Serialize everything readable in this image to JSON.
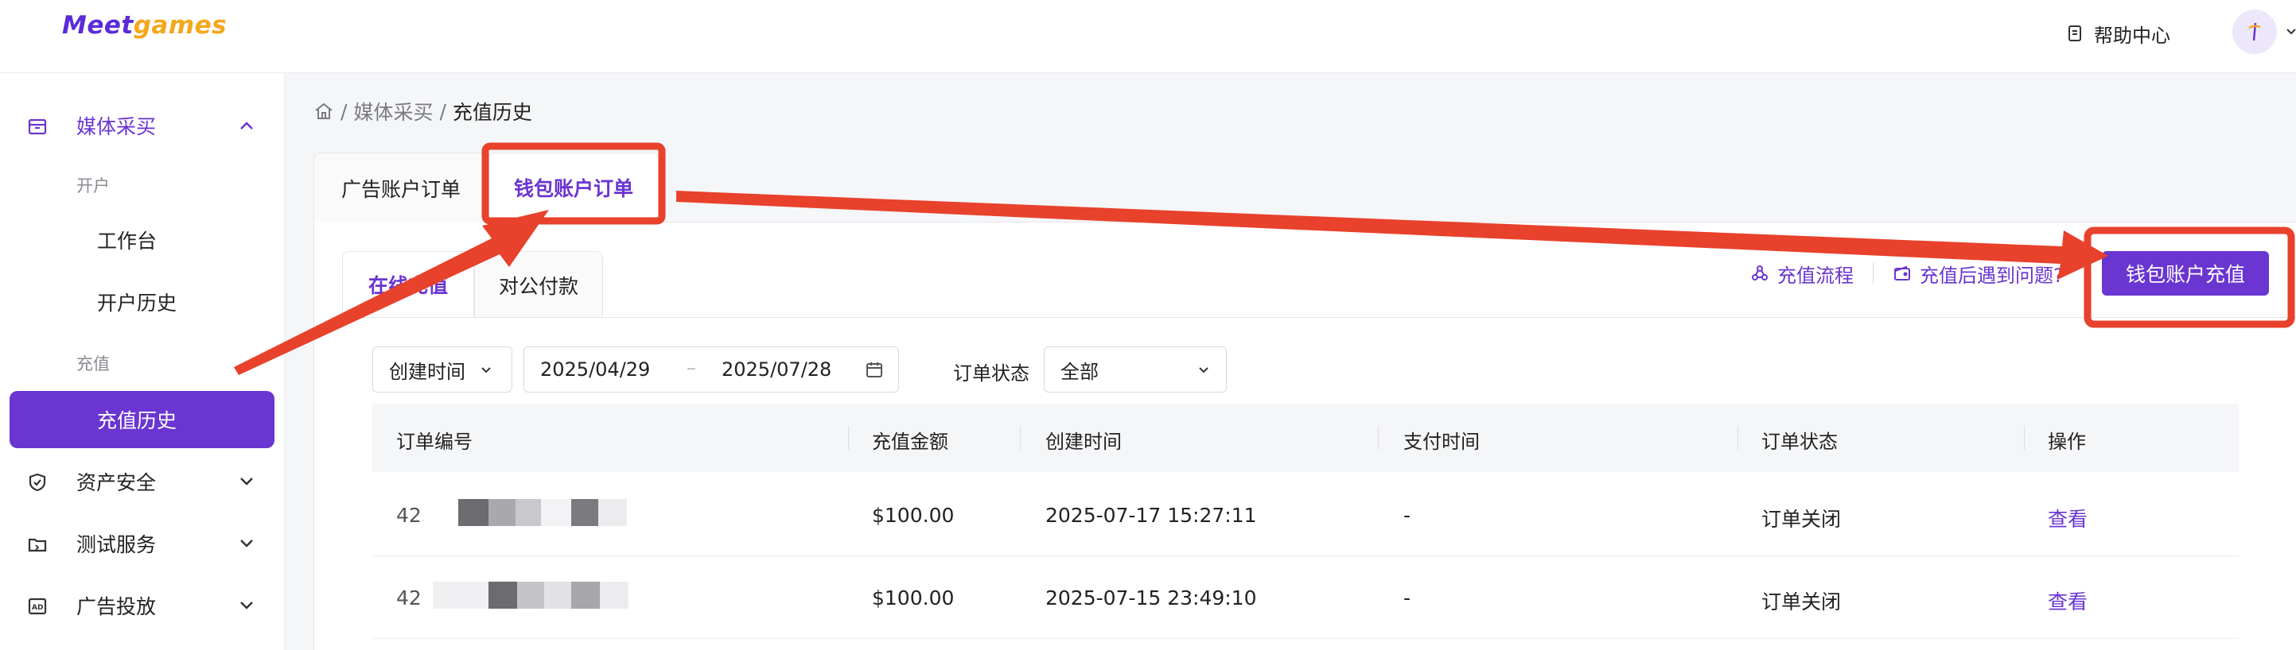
{
  "brand": {
    "logo_part1": "Meet",
    "logo_part2": "games"
  },
  "header": {
    "help_label": "帮助中心"
  },
  "sidebar": {
    "media": "媒体采买",
    "group_open": "开户",
    "workbench": "工作台",
    "open_history": "开户历史",
    "group_recharge": "充值",
    "recharge_history": "充值历史",
    "asset_security": "资产安全",
    "test_service": "测试服务",
    "ad_delivery": "广告投放"
  },
  "breadcrumb": {
    "sep": "/",
    "level1": "媒体采买",
    "level2": "充值历史"
  },
  "tabs": {
    "ad_orders": "广告账户订单",
    "wallet_orders": "钱包账户订单"
  },
  "subtabs": {
    "online": "在线充值",
    "corporate": "对公付款"
  },
  "links": {
    "flow": "充值流程",
    "problem": "充值后遇到问题?"
  },
  "actions": {
    "wallet_recharge": "钱包账户充值"
  },
  "filters": {
    "time_type": "创建时间",
    "date_start": "2025/04/29",
    "date_sep": "–",
    "date_end": "2025/07/28",
    "status_label": "订单状态",
    "status_value": "全部"
  },
  "table": {
    "headers": [
      "订单编号",
      "充值金额",
      "创建时间",
      "支付时间",
      "订单状态",
      "操作"
    ],
    "rows": [
      {
        "order_no": "425",
        "amount": "$100.00",
        "created": "2025-07-17 15:27:11",
        "paid": "-",
        "status": "订单关闭",
        "action": "查看"
      },
      {
        "order_no": "42",
        "amount": "$100.00",
        "created": "2025-07-15 23:49:10",
        "paid": "-",
        "status": "订单关闭",
        "action": "查看"
      }
    ]
  },
  "colors": {
    "primary": "#6a35d0",
    "annotation_red": "#e8412c",
    "logo_yellow": "#f3a81d"
  }
}
